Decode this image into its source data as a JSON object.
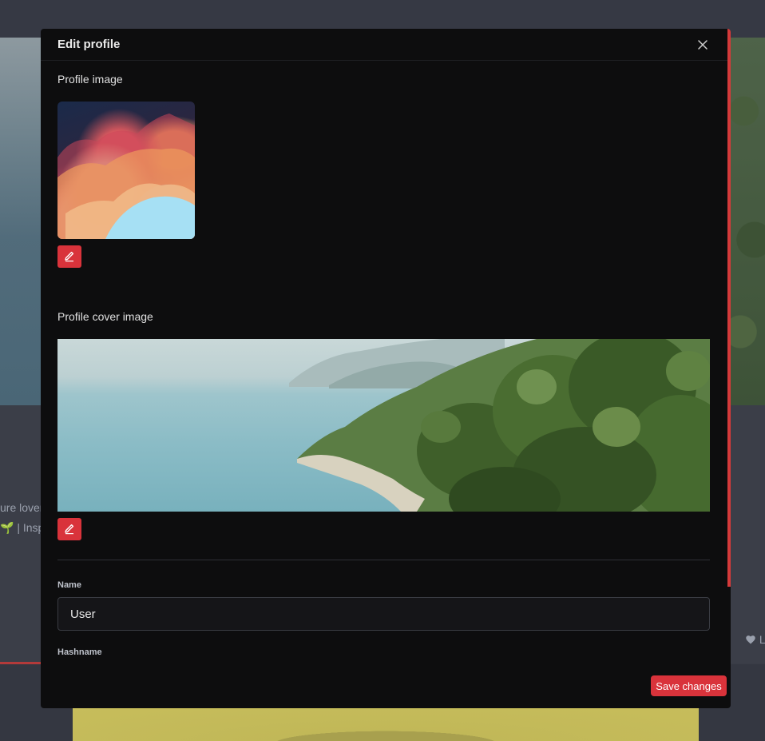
{
  "background": {
    "bio_line_1": "ure lover",
    "bio_line_2_icon": "🌱",
    "bio_line_2": "| Inspi",
    "like_label": "L"
  },
  "modal": {
    "title": "Edit profile",
    "close_icon": "close-icon",
    "profile_image_label": "Profile image",
    "cover_image_label": "Profile cover image",
    "edit_icon": "pencil-icon",
    "fields": {
      "name_label": "Name",
      "name_value": "User",
      "hashname_label": "Hashname"
    },
    "save_label": "Save changes"
  },
  "colors": {
    "accent": "#d9333b",
    "modal_bg": "#0d0d0e",
    "backdrop": "#3a3d47"
  }
}
